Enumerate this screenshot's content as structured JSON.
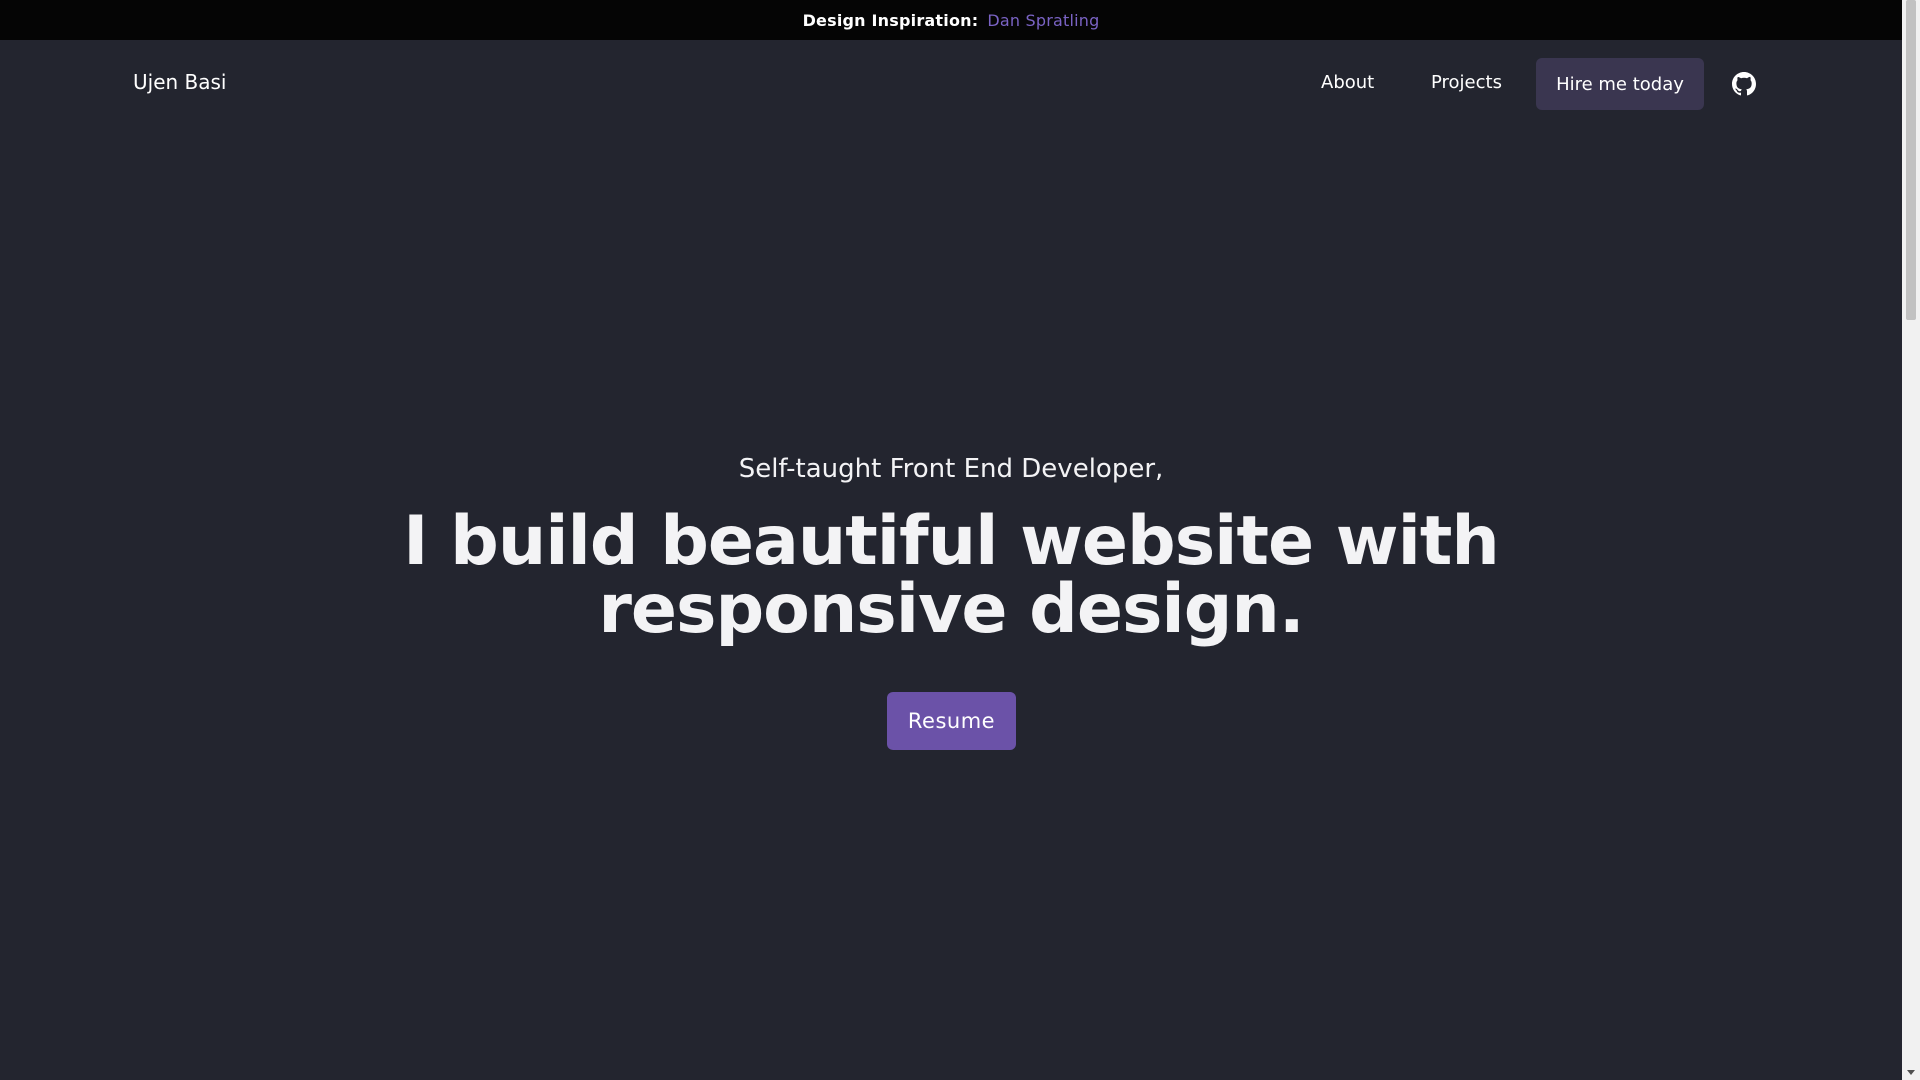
{
  "banner": {
    "label": "Design Inspiration:",
    "link_text": "Dan Spratling"
  },
  "nav": {
    "brand": "Ujen Basi",
    "items": [
      {
        "label": "About"
      },
      {
        "label": "Projects"
      }
    ],
    "cta_label": "Hire me today",
    "github_icon": "github-icon"
  },
  "hero": {
    "subtitle": "Self-taught Front End Developer,",
    "title_line1": "I build beautiful website with",
    "title_line2": "responsive design.",
    "resume_label": "Resume"
  },
  "colors": {
    "background": "#23252f",
    "banner_bg": "#050505",
    "accent": "#6b52a8",
    "link": "#7a63c4",
    "cta_bg": "#3a3650"
  }
}
